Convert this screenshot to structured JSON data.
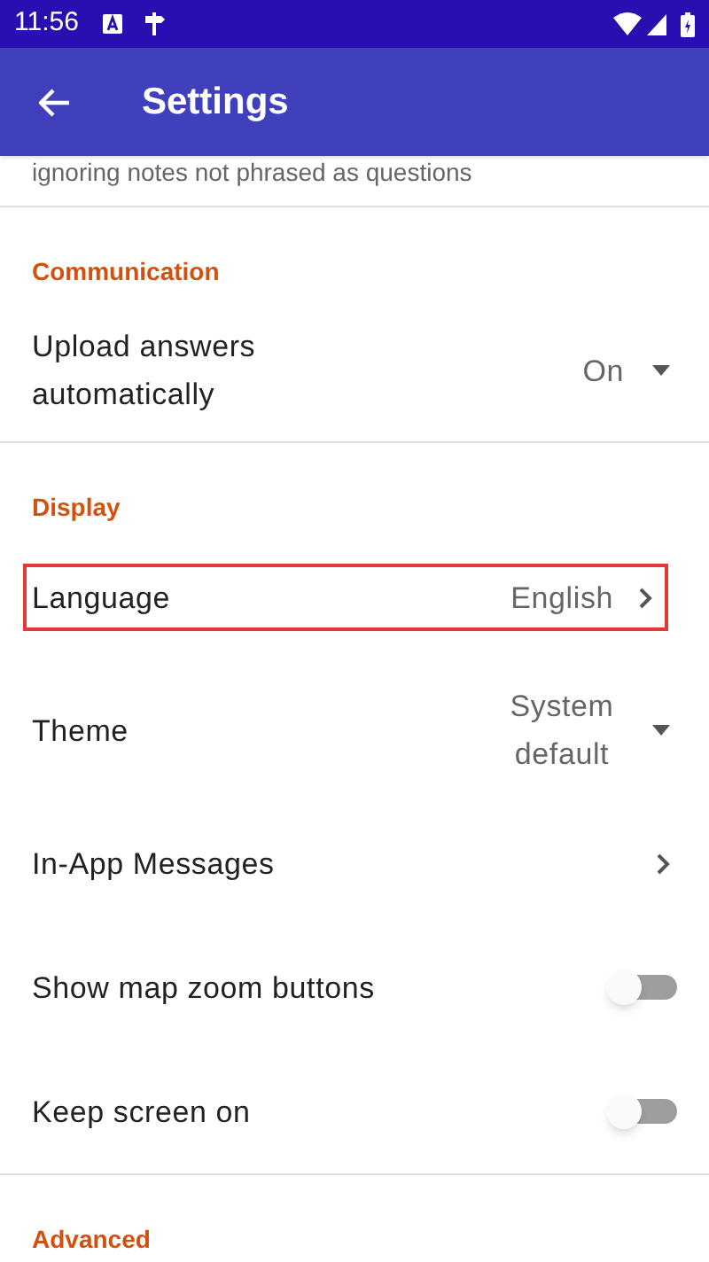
{
  "status_bar": {
    "time": "11:56"
  },
  "app_bar": {
    "title": "Settings"
  },
  "scrolled_note": "ignoring notes not phrased as questions",
  "sections": [
    {
      "header": "Communication",
      "items": [
        {
          "kind": "dropdown",
          "title": "Upload answers automatically",
          "value": "On",
          "highlighted": false
        }
      ]
    },
    {
      "header": "Display",
      "items": [
        {
          "kind": "link",
          "title": "Language",
          "value": "English",
          "highlighted": true
        },
        {
          "kind": "dropdown",
          "title": "Theme",
          "value": "System default",
          "highlighted": false
        },
        {
          "kind": "link",
          "title": "In-App Messages",
          "highlighted": false
        },
        {
          "kind": "toggle",
          "title": "Show map zoom buttons",
          "on": false,
          "highlighted": false
        },
        {
          "kind": "toggle",
          "title": "Keep screen on",
          "on": false,
          "highlighted": false
        }
      ]
    },
    {
      "header": "Advanced"
    }
  ]
}
